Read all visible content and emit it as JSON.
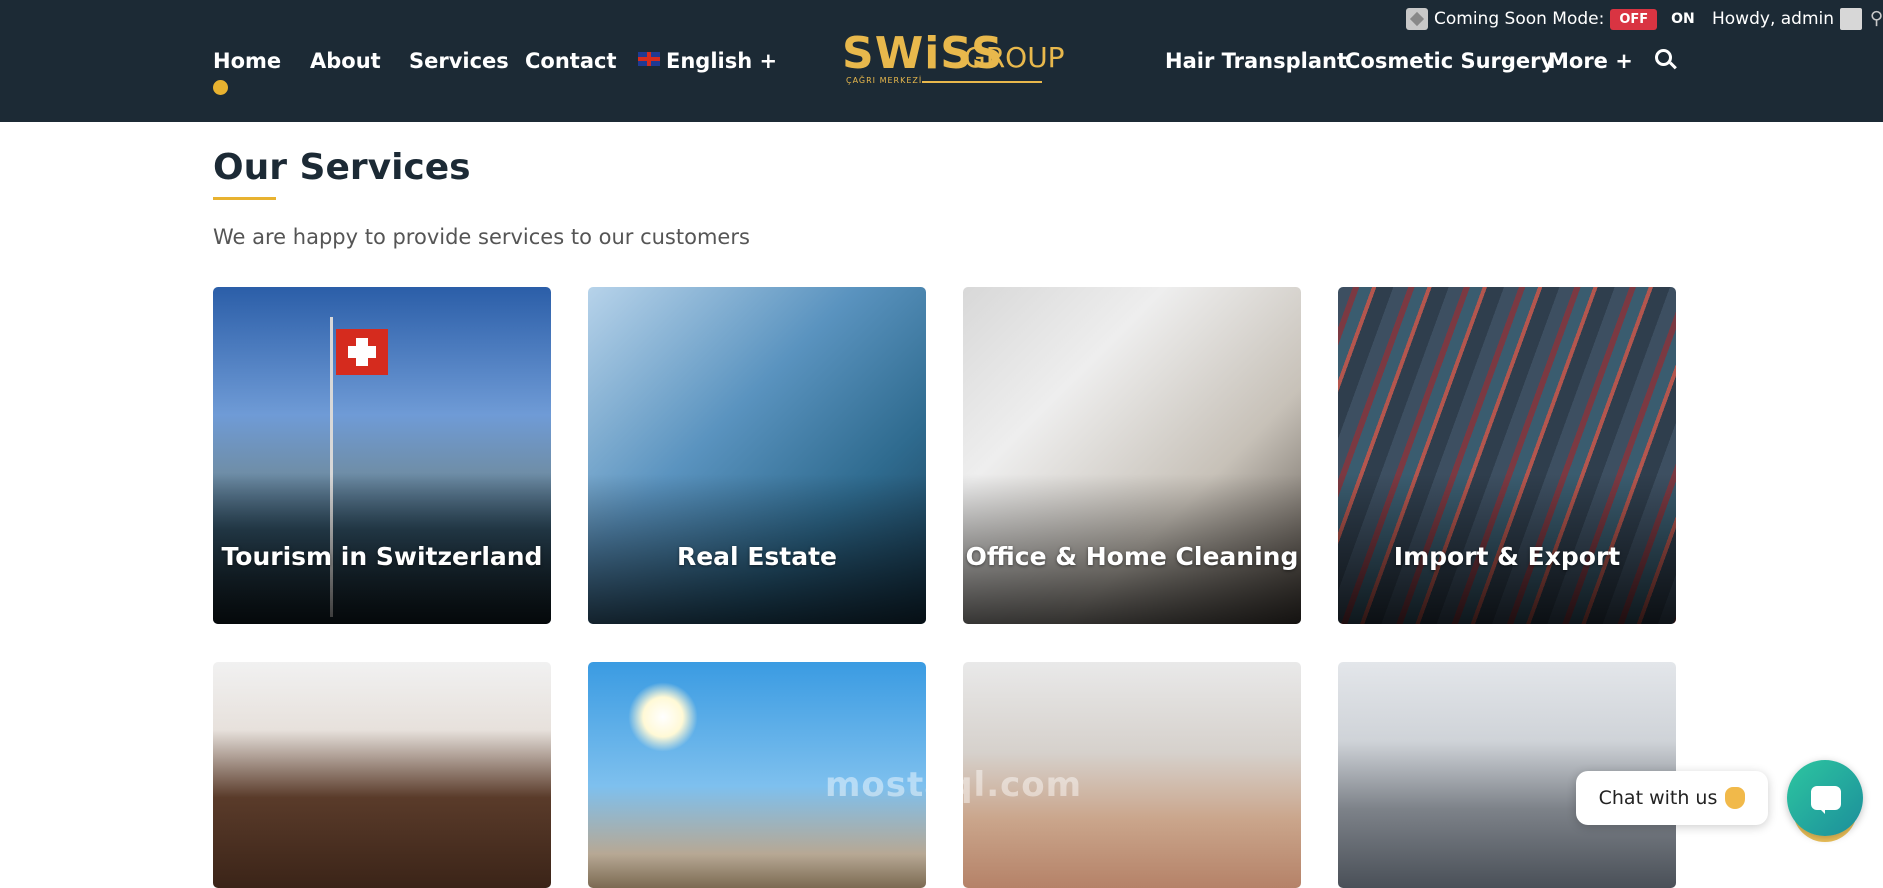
{
  "admin_bar": {
    "coming_soon_label": "Coming Soon Mode:",
    "off_label": "OFF",
    "on_label": "ON",
    "howdy": "Howdy, admin"
  },
  "nav": {
    "left": [
      {
        "label": "Home"
      },
      {
        "label": "About"
      },
      {
        "label": "Services"
      },
      {
        "label": "Contact"
      }
    ],
    "language": "English +",
    "logo_main": "SWiSS",
    "logo_group": "GROUP",
    "logo_sub": "ÇAĞRI MERKEZİ",
    "right": [
      {
        "label": "Hair Transplant"
      },
      {
        "label": "Cosmetic Surgery"
      },
      {
        "label": "More +"
      }
    ]
  },
  "section": {
    "title": "Our Services",
    "subtitle": "We are happy to provide services to our customers"
  },
  "cards": [
    {
      "label": "Tourism in Switzerland"
    },
    {
      "label": "Real Estate"
    },
    {
      "label": "Office & Home Cleaning"
    },
    {
      "label": "Import & Export"
    }
  ],
  "chat": {
    "label": "Chat with us"
  },
  "watermark": "mostaql.com"
}
